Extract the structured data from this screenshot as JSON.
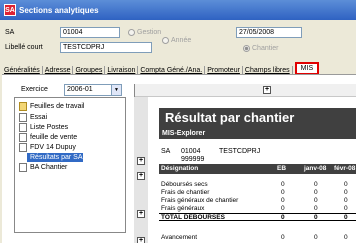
{
  "window": {
    "title": "Sections analytiques",
    "icon_letters": "SA"
  },
  "header": {
    "code_label": "SA",
    "code_value": "01004",
    "radio_gestion": "Gestion",
    "date_value": "27/05/2008",
    "libelle_label": "Libellé court",
    "libelle_value": "TESTCDPRJ",
    "radio_annee": "Année",
    "radio_chantier": "Chantier"
  },
  "tabs": [
    "Généralités",
    "Adresse",
    "Groupes",
    "Livraison",
    "Compta Géné./Ana.",
    "Promoteur",
    "Champs libres",
    "MIS"
  ],
  "panel": {
    "exercice_label": "Exercice",
    "exercice_value": "2006-01"
  },
  "tree": {
    "items": [
      "Feuilles de travail",
      "Essai",
      "Liste Postes",
      "feuille de vente",
      "FDV 14 Dupuy",
      "Résultats par SA",
      "BA Chantier"
    ],
    "selected_index": 5
  },
  "report": {
    "title": "Résultat par chantier",
    "subtitle": "MIS-Explorer",
    "sa_label": "SA",
    "sa_code": "01004",
    "sa_name": "TESTCDPRJ",
    "sa_extra": "999999",
    "columns": [
      "Désignation",
      "EB",
      "janv-08",
      "févr-08"
    ],
    "rows": [
      {
        "label": "Déboursés secs",
        "eb": "0",
        "jan": "0",
        "feb": "0"
      },
      {
        "label": "Frais de chantier",
        "eb": "0",
        "jan": "0",
        "feb": "0"
      },
      {
        "label": "Frais généraux de chantier",
        "eb": "0",
        "jan": "0",
        "feb": "0"
      },
      {
        "label": "Frais généraux",
        "eb": "0",
        "jan": "0",
        "feb": "0"
      },
      {
        "label": "TOTAL DEBOURSES",
        "eb": "0",
        "jan": "0",
        "feb": "0"
      },
      {
        "label": "",
        "eb": "",
        "jan": "",
        "feb": ""
      },
      {
        "label": "Avancement",
        "eb": "0",
        "jan": "0",
        "feb": "0"
      }
    ]
  }
}
